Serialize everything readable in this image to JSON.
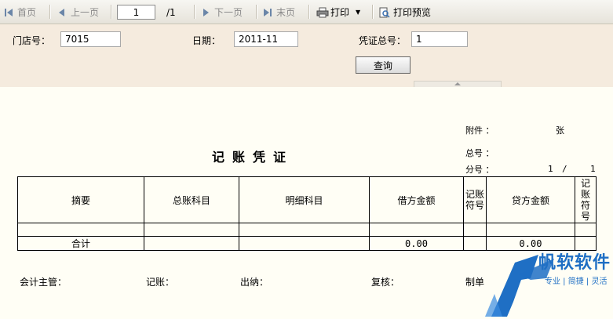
{
  "toolbar": {
    "first": "首页",
    "prev": "上一页",
    "page_value": "1",
    "page_total": "/1",
    "next": "下一页",
    "last": "末页",
    "print": "打印",
    "print_preview": "打印预览"
  },
  "form": {
    "store_label": "门店号：",
    "store_value": "7015",
    "date_label": "日期：",
    "date_value": "2011-11",
    "voucher_total_label": "凭证总号：",
    "voucher_total_value": "1",
    "query_button": "查询"
  },
  "report": {
    "title": "记账凭证",
    "attachment_label": "附件 ：",
    "attachment_unit": "张",
    "total_no_label": "总号 ：",
    "sub_no_label": "分号 ：",
    "sub_no_current": "1",
    "sub_no_sep": "/",
    "sub_no_total": "1",
    "columns": {
      "summary": "摘要",
      "general_account": "总账科目",
      "detail_account": "明细科目",
      "debit": "借方金额",
      "posted1": [
        "记账",
        "符号"
      ],
      "credit": "贷方金额",
      "posted2": [
        "记",
        "账",
        "符",
        "号"
      ]
    },
    "total_row": {
      "label": "合计",
      "debit": "0.00",
      "credit": "0.00"
    },
    "signatures": {
      "supervisor": "会计主管：",
      "bookkeeper": "记账：",
      "cashier": "出纳：",
      "reviewer": "复核：",
      "maker": "制单"
    }
  },
  "watermark": {
    "brand": "帆软软件",
    "slogan": "专业 | 简捷 | 灵活"
  },
  "colors": {
    "accent_blue": "#1f6fc4",
    "toolbar_bg": "#ece9e0",
    "form_bg": "#f5ebde",
    "report_bg": "#fffef5"
  }
}
